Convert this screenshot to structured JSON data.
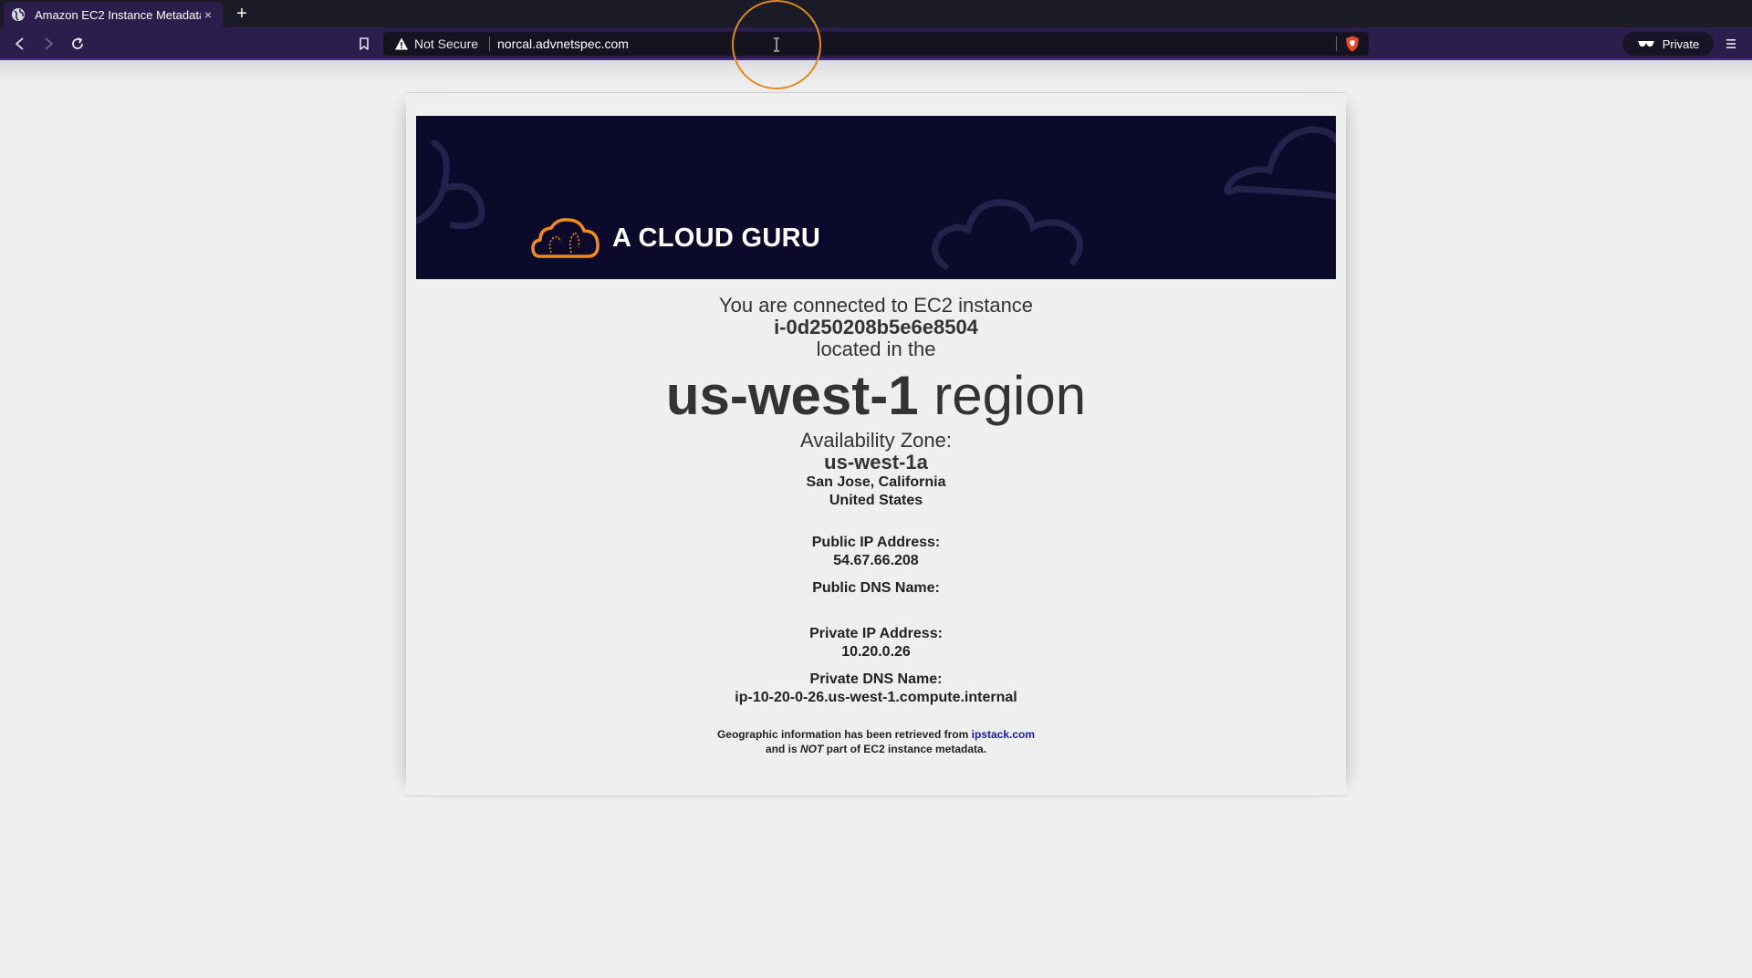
{
  "browser": {
    "tab_title": "Amazon EC2 Instance Metadata",
    "tab_close": "×",
    "new_tab": "+",
    "security_label": "Not Secure",
    "url": "norcal.advnetspec.com",
    "private_label": "Private",
    "icons": [
      "globe-icon",
      "back-icon",
      "forward-icon",
      "reload-icon",
      "bookmark-icon",
      "warning-icon",
      "brave-shield-icon",
      "private-glasses-icon",
      "menu-icon",
      "text-cursor-icon"
    ]
  },
  "banner": {
    "logo_text": "A CLOUD GURU",
    "background": "#0c0a2b",
    "logo_color": "#f08c1e"
  },
  "info": {
    "connected_text": "You are connected to EC2 instance",
    "instance_id": "i-0d250208b5e6e8504",
    "located_text": "located in the",
    "region": "us-west-1",
    "region_suffix": " region",
    "az_label": "Availability Zone:",
    "az": "us-west-1a",
    "city": "San Jose, California",
    "country": "United States",
    "public_ip_label": "Public IP Address:",
    "public_ip": "54.67.66.208",
    "public_dns_label": "Public DNS Name:",
    "public_dns": "",
    "private_ip_label": "Private IP Address:",
    "private_ip": "10.20.0.26",
    "private_dns_label": "Private DNS Name:",
    "private_dns": "ip-10-20-0-26.us-west-1.compute.internal"
  },
  "footnote": {
    "line1_prefix": "Geographic information has been retrieved from ",
    "link_text": "ipstack.com",
    "line2_prefix": "and is ",
    "line2_emph": "NOT",
    "line2_suffix": " part of EC2 instance metadata."
  }
}
